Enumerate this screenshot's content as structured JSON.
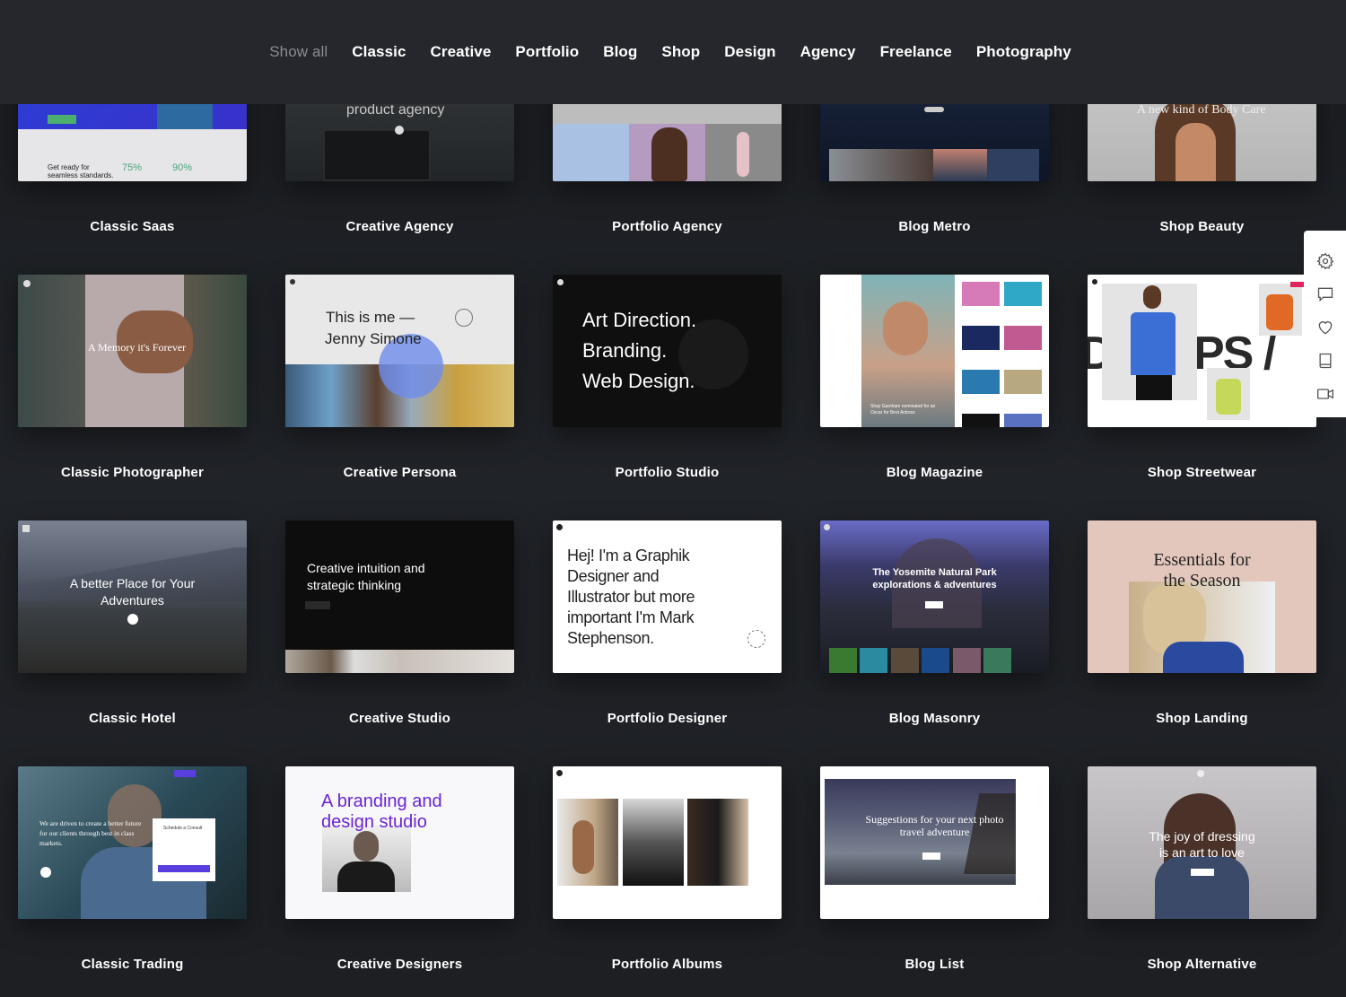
{
  "filters": [
    {
      "label": "Show all",
      "active": false
    },
    {
      "label": "Classic",
      "active": true
    },
    {
      "label": "Creative",
      "active": true
    },
    {
      "label": "Portfolio",
      "active": true
    },
    {
      "label": "Blog",
      "active": true
    },
    {
      "label": "Shop",
      "active": true
    },
    {
      "label": "Design",
      "active": true
    },
    {
      "label": "Agency",
      "active": true
    },
    {
      "label": "Freelance",
      "active": true
    },
    {
      "label": "Photography",
      "active": true
    }
  ],
  "side_panel": {
    "icons": [
      "gear-icon",
      "chat-icon",
      "heart-icon",
      "book-icon",
      "video-camera-icon"
    ]
  },
  "cards": [
    {
      "title": "Classic Saas",
      "preview": {
        "heading": "Get ready for seamless standards.",
        "stat1": "75%",
        "stat2": "90%"
      }
    },
    {
      "title": "Creative Agency",
      "preview": {
        "heading": "product agency"
      }
    },
    {
      "title": "Portfolio Agency",
      "preview": {}
    },
    {
      "title": "Blog Metro",
      "preview": {}
    },
    {
      "title": "Shop Beauty",
      "preview": {
        "heading": "A new kind of Body Care"
      }
    },
    {
      "title": "Classic Photographer",
      "preview": {
        "heading": "A Memory it's Forever"
      }
    },
    {
      "title": "Creative Persona",
      "preview": {
        "line1": "This is me —",
        "line2": "Jenny Simone"
      }
    },
    {
      "title": "Portfolio Studio",
      "preview": {
        "line1": "Art Direction.",
        "line2": "Branding.",
        "line3": "Web Design."
      }
    },
    {
      "title": "Blog Magazine",
      "preview": {
        "caption": "Shay Gamham nominated for an Oscar for Best Actress"
      }
    },
    {
      "title": "Shop Streetwear",
      "preview": {
        "big": "PS / "
      }
    },
    {
      "title": "Classic Hotel",
      "preview": {
        "line1": "A better Place for Your",
        "line2": "Adventures"
      }
    },
    {
      "title": "Creative Studio",
      "preview": {
        "line1": "Creative intuition and",
        "line2": "strategic thinking"
      }
    },
    {
      "title": "Portfolio Designer",
      "preview": {
        "text": "Hej! I'm a Graphik Designer and Illustrator but more important I'm Mark Stephenson."
      }
    },
    {
      "title": "Blog Masonry",
      "preview": {
        "line1": "The Yosemite Natural Park",
        "line2": "explorations & adventures"
      }
    },
    {
      "title": "Shop Landing",
      "preview": {
        "line1": "Essentials for",
        "line2": "the Season"
      }
    },
    {
      "title": "Classic Trading",
      "preview": {
        "heading": "We are driven to create a better future for our clients through best in class markets.",
        "form_title": "Schedule a Consult"
      }
    },
    {
      "title": "Creative Designers",
      "preview": {
        "line1": "A branding and",
        "line2": "design studio"
      }
    },
    {
      "title": "Portfolio Albums",
      "preview": {}
    },
    {
      "title": "Blog List",
      "preview": {
        "line1": "Suggestions for your next photo",
        "line2": "travel adventure"
      }
    },
    {
      "title": "Shop Alternative",
      "preview": {
        "line1": "The joy of dressing",
        "line2": "is an art to love"
      }
    }
  ]
}
